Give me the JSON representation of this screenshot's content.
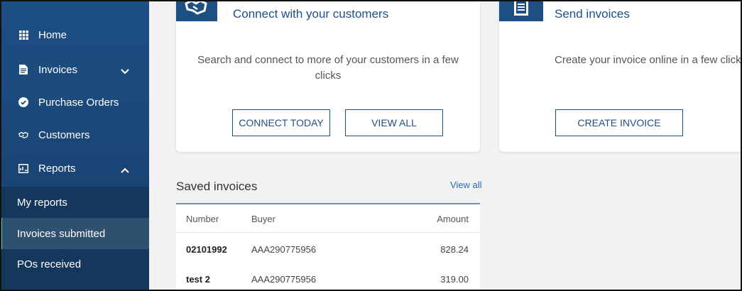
{
  "sidebar": {
    "items": [
      {
        "label": "Home",
        "icon": "grid-icon"
      },
      {
        "label": "Invoices",
        "icon": "document-icon",
        "chevron": "chevron-down-icon"
      },
      {
        "label": "Purchase Orders",
        "icon": "check-circle-icon"
      },
      {
        "label": "Customers",
        "icon": "handshake-icon"
      },
      {
        "label": "Reports",
        "icon": "report-icon",
        "chevron": "chevron-up-icon"
      }
    ],
    "report_sub_items": [
      {
        "label": "My reports",
        "active": false
      },
      {
        "label": "Invoices submitted",
        "active": true
      },
      {
        "label": "POs received",
        "active": false
      }
    ]
  },
  "cards": {
    "connect": {
      "title": "Connect with your customers",
      "text": "Search and connect to more of your customers in a few clicks",
      "buttons": {
        "primary": "CONNECT TODAY",
        "secondary": "VIEW ALL"
      },
      "icon": "handshake-icon"
    },
    "send": {
      "title": "Send invoices",
      "text": "Create your invoice online in a few clicks",
      "buttons": {
        "primary": "CREATE INVOICE"
      },
      "icon": "invoice-list-icon"
    }
  },
  "saved_invoices": {
    "title": "Saved invoices",
    "view_all": "View all",
    "columns": {
      "number": "Number",
      "buyer": "Buyer",
      "amount": "Amount"
    },
    "rows": [
      {
        "number": "02101992",
        "buyer": "AAA290775956",
        "amount": "828.24"
      },
      {
        "number": "test 2",
        "buyer": "AAA290775956",
        "amount": "319.00"
      }
    ]
  },
  "colors": {
    "sidebar": "#1d4f83",
    "accent": "#1f4f85",
    "active_indicator": "#5fd0c0"
  }
}
